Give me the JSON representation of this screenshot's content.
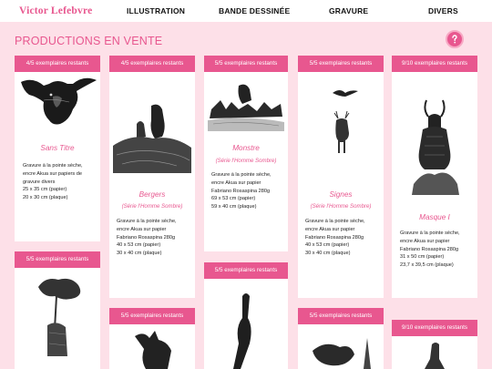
{
  "header": {
    "logo": "Victor Lefebvre",
    "nav": [
      "ILLUSTRATION",
      "BANDE DESSINÉE",
      "GRAVURE",
      "DIVERS"
    ]
  },
  "page": {
    "title": "PRODUCTIONS EN VENTE",
    "help_label": "?"
  },
  "colors": {
    "accent": "#e8578f",
    "background": "#fde0e8"
  },
  "cards": [
    {
      "stock": "4/5 exemplaires restants",
      "title": "Sans Titre",
      "subtitle": "",
      "desc": [
        "Gravure à la pointe sèche,",
        "encre Akua sur papiers de",
        "gravure divers",
        "25 x 35 cm (papier)",
        "20 x 30 cm (plaque)"
      ]
    },
    {
      "stock": "4/5 exemplaires restants",
      "title": "Bergers",
      "subtitle": "(Série l'Homme Sombre)",
      "desc": [
        "Gravure à la pointe sèche,",
        "encre Akua sur papier",
        "Fabriano Rosaspina 280g",
        "40 x 53 cm (papier)",
        "30 x 40 cm (plaque)"
      ]
    },
    {
      "stock": "5/5 exemplaires restants",
      "title": "Monstre",
      "subtitle": "(Série l'Homme Sombre)",
      "desc": [
        "Gravure à la pointe sèche,",
        "encre Akua sur papier",
        "Fabriano Rosaspina 280g",
        "69 x 53 cm (papier)",
        "59 x 40 cm (plaque)"
      ]
    },
    {
      "stock": "5/5 exemplaires restants",
      "title": "Signes",
      "subtitle": "(Série l'Homme Sombre)",
      "desc": [
        "Gravure à la pointe sèche,",
        "encre Akua sur papier",
        "Fabriano Rosaspina 280g",
        "40 x 53 cm (papier)",
        "30 x 40 cm (plaque)"
      ]
    },
    {
      "stock": "9/10 exemplaires restants",
      "title": "Masque I",
      "subtitle": "",
      "desc": [
        "Gravure à la pointe sèche,",
        "encre Akua sur papier",
        "Fabriano Rosaspina 280g",
        "31 x 50 cm (papier)",
        "23,7 x 39,5 cm (plaque)"
      ]
    },
    {
      "stock": "5/5 exemplaires restants"
    },
    {
      "stock": "5/5 exemplaires restants"
    },
    {
      "stock": "5/5 exemplaires restants"
    },
    {
      "stock": "5/5 exemplaires restants"
    },
    {
      "stock": "9/10 exemplaires restants"
    }
  ],
  "icons": {
    "help": "question-mark-circle-icon",
    "artworks": [
      "bull-head-etching",
      "two-animals-on-hill-etching",
      "figures-by-water-etching",
      "deer-and-bird-etching",
      "antelope-masked-figure-etching",
      "tree-and-animal-etching",
      "fox-etching",
      "bird-head-figure-etching",
      "bird-creature-etching",
      "figure-on-rock-etching"
    ]
  }
}
